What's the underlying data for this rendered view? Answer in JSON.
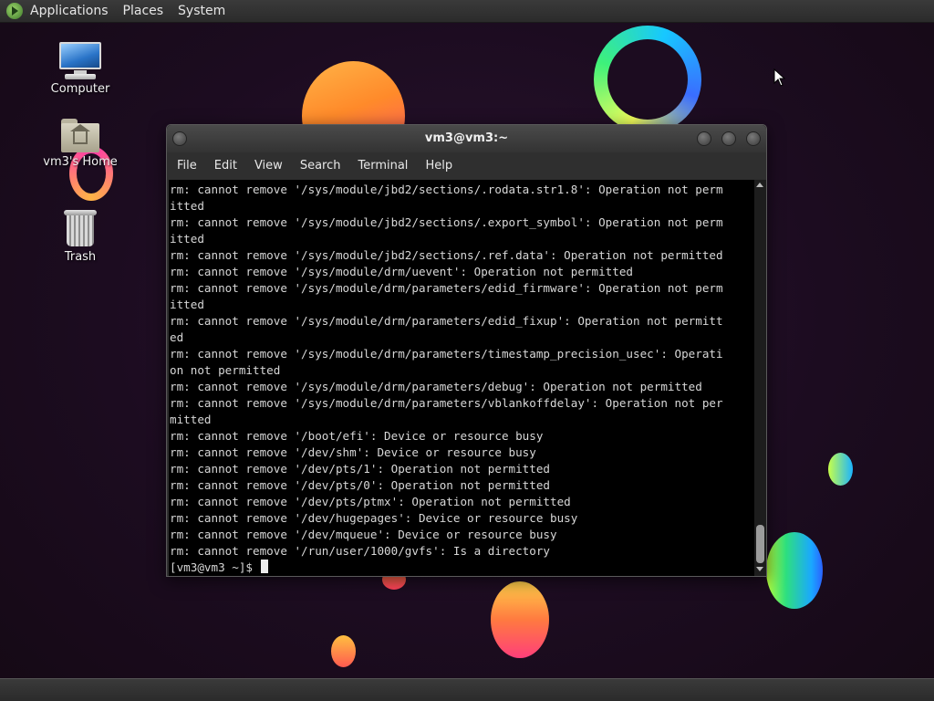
{
  "top_panel": {
    "menus": [
      "Applications",
      "Places",
      "System"
    ]
  },
  "desktop": {
    "icons": [
      {
        "label": "Computer",
        "icon": "computer-icon"
      },
      {
        "label": "vm3's Home",
        "icon": "home-folder-icon"
      },
      {
        "label": "Trash",
        "icon": "trash-icon"
      }
    ]
  },
  "terminal": {
    "title": "vm3@vm3:~",
    "menus": [
      "File",
      "Edit",
      "View",
      "Search",
      "Terminal",
      "Help"
    ],
    "lines": [
      "rm: cannot remove '/sys/module/jbd2/sections/.rodata.str1.8': Operation not perm",
      "itted",
      "rm: cannot remove '/sys/module/jbd2/sections/.export_symbol': Operation not perm",
      "itted",
      "rm: cannot remove '/sys/module/jbd2/sections/.ref.data': Operation not permitted",
      "rm: cannot remove '/sys/module/drm/uevent': Operation not permitted",
      "rm: cannot remove '/sys/module/drm/parameters/edid_firmware': Operation not perm",
      "itted",
      "rm: cannot remove '/sys/module/drm/parameters/edid_fixup': Operation not permitt",
      "ed",
      "rm: cannot remove '/sys/module/drm/parameters/timestamp_precision_usec': Operati",
      "on not permitted",
      "rm: cannot remove '/sys/module/drm/parameters/debug': Operation not permitted",
      "rm: cannot remove '/sys/module/drm/parameters/vblankoffdelay': Operation not per",
      "mitted",
      "rm: cannot remove '/boot/efi': Device or resource busy",
      "rm: cannot remove '/dev/shm': Device or resource busy",
      "rm: cannot remove '/dev/pts/1': Operation not permitted",
      "rm: cannot remove '/dev/pts/0': Operation not permitted",
      "rm: cannot remove '/dev/pts/ptmx': Operation not permitted",
      "rm: cannot remove '/dev/hugepages': Device or resource busy",
      "rm: cannot remove '/dev/mqueue': Device or resource busy",
      "rm: cannot remove '/run/user/1000/gvfs': Is a directory"
    ],
    "prompt": "[vm3@vm3 ~]$ "
  }
}
